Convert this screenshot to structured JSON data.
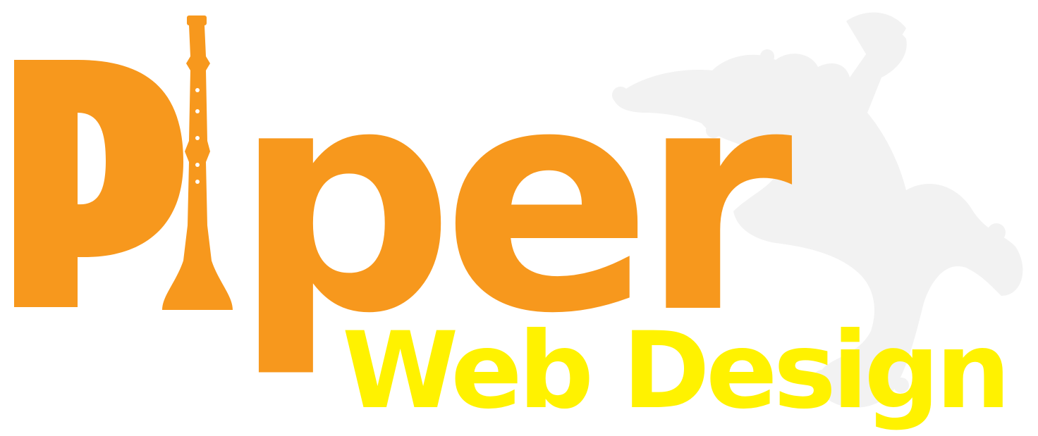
{
  "logo": {
    "wordmark": "Piper",
    "wordmark_rest": "per",
    "tagline": "Web Design",
    "colors": {
      "orange": "#F7981D",
      "yellow": "#FFF200",
      "silhouette": "#F2F2F2",
      "background": "#FFFFFF"
    },
    "icons": [
      "clarinet-icon",
      "jester-piper-silhouette"
    ]
  }
}
